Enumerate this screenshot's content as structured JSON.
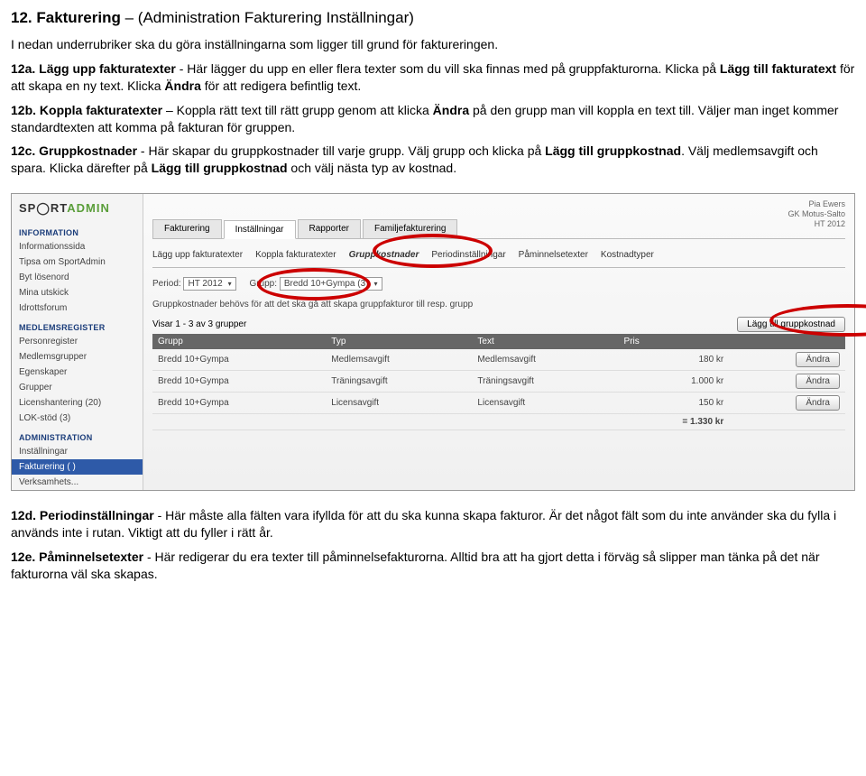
{
  "doc": {
    "h12": "12. Fakturering",
    "h12_light": " – (Administration Fakturering Inställningar)",
    "intro": "I nedan underrubriker ska du göra inställningarna som ligger till grund för faktureringen.",
    "p12a_lead": "12a. Lägg upp fakturatexter",
    "p12a_rest": " - Här lägger du upp en eller flera texter som du vill ska finnas med på gruppfakturorna. Klicka på ",
    "p12a_bold2": "Lägg till fakturatext",
    "p12a_rest2": " för att skapa en ny text. Klicka ",
    "p12a_bold3": "Ändra",
    "p12a_rest3": " för att redigera befintlig text.",
    "p12b_lead": "12b. Koppla fakturatexter",
    "p12b_rest": " – Koppla rätt text till rätt grupp genom att klicka ",
    "p12b_bold2": "Ändra",
    "p12b_rest2": " på den grupp man vill koppla en text till. Väljer man inget kommer standardtexten att komma på fakturan för gruppen.",
    "p12c_lead": "12c. Gruppkostnader",
    "p12c_rest": " - Här skapar du gruppkostnader till varje grupp. Välj grupp och klicka på ",
    "p12c_bold2": "Lägg till gruppkostnad",
    "p12c_rest2": ". Välj medlemsavgift och spara. Klicka därefter på ",
    "p12c_bold3": "Lägg till gruppkostnad",
    "p12c_rest3": " och välj nästa typ av kostnad.",
    "p12d_lead": "12d. Periodinställningar",
    "p12d_rest": " - Här måste alla fälten vara ifyllda för att du ska kunna skapa fakturor. Är det något fält som du inte använder ska du fylla i används inte i rutan. Viktigt att du fyller i rätt år.",
    "p12e_lead": "12e. Påminnelsetexter",
    "p12e_rest": " - Här redigerar du era texter till påminnelsefakturorna. Alltid bra att ha gjort detta i förväg så slipper man tänka på det när fakturorna väl ska skapas."
  },
  "shot": {
    "brand1": "SP",
    "brand_icon": "◯",
    "brand2": "RT",
    "brand3": "ADMIN",
    "user_l1": "Pia Ewers",
    "user_l2": "GK Motus-Salto",
    "user_l3": "HT 2012",
    "sidebar": {
      "blocks": [
        {
          "title": "INFORMATION",
          "items": [
            "Informationssida",
            "Tipsa om SportAdmin",
            "Byt lösenord",
            "Mina utskick",
            "Idrottsforum"
          ]
        },
        {
          "title": "MEDLEMSREGISTER",
          "items": [
            "Personregister",
            "Medlemsgrupper",
            "Egenskaper",
            "Grupper",
            "Licenshantering (20)",
            "LOK-stöd (3)"
          ]
        },
        {
          "title": "ADMINISTRATION",
          "items": [
            "Inställningar",
            "Fakturering ( )",
            "Verksamhets..."
          ]
        }
      ],
      "active": "Fakturering ( )"
    },
    "tabs1": [
      "Fakturering",
      "Inställningar",
      "Rapporter",
      "Familjefakturering"
    ],
    "tabs1_active": "Inställningar",
    "tabs2": [
      "Lägg upp fakturatexter",
      "Koppla fakturatexter",
      "Gruppkostnader",
      "Periodinställningar",
      "Påminnelsetexter",
      "Kostnadtyper"
    ],
    "tabs2_active": "Gruppkostnader",
    "filters": {
      "period_label": "Period:",
      "period_value": "HT 2012",
      "group_label": "Grupp:",
      "group_value": "Bredd 10+Gympa (3)"
    },
    "hint": "Gruppkostnader behövs för att det ska gå att skapa gruppfakturor till resp. grupp",
    "result_text": "Visar 1 - 3 av 3 grupper",
    "add_btn": "Lägg till gruppkostnad",
    "table": {
      "headers": [
        "Grupp",
        "Typ",
        "Text",
        "Pris",
        ""
      ],
      "rows": [
        {
          "g": "Bredd 10+Gympa",
          "t": "Medlemsavgift",
          "x": "Medlemsavgift",
          "p": "180 kr",
          "a": "Ändra"
        },
        {
          "g": "Bredd 10+Gympa",
          "t": "Träningsavgift",
          "x": "Träningsavgift",
          "p": "1.000 kr",
          "a": "Ändra"
        },
        {
          "g": "Bredd 10+Gympa",
          "t": "Licensavgift",
          "x": "Licensavgift",
          "p": "150 kr",
          "a": "Ändra"
        }
      ],
      "sum": "= 1.330 kr"
    }
  }
}
